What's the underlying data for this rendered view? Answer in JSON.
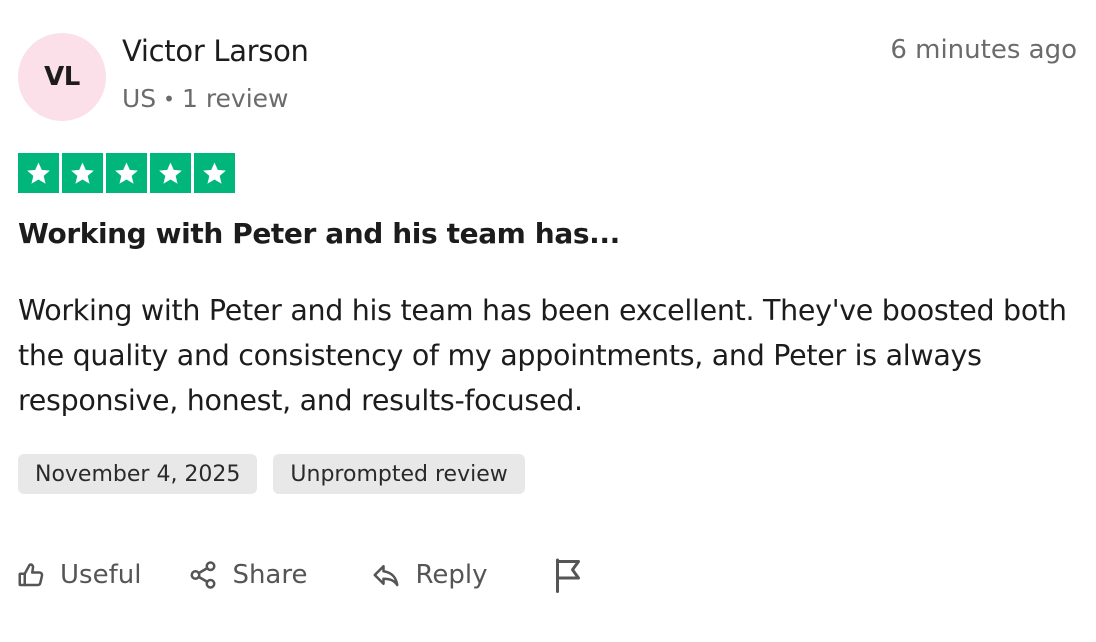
{
  "reviewer": {
    "initials": "VL",
    "name": "Victor Larson",
    "country": "US",
    "separator": "•",
    "review_count": "1 review",
    "avatar_color": "#fbe0ea"
  },
  "timestamp": "6 minutes ago",
  "rating": {
    "stars": 5,
    "max": 5,
    "color": "#00b67a",
    "icon": "star-icon"
  },
  "review": {
    "title": "Working with Peter and his team has...",
    "body": "Working with Peter and his team has been excellent. They've boosted both the quality and consistency of my appointments, and Peter is always responsive, honest, and results-focused."
  },
  "tags": [
    "November 4, 2025",
    "Unprompted review"
  ],
  "actions": {
    "useful": {
      "label": "Useful",
      "icon": "thumbs-up-icon"
    },
    "share": {
      "label": "Share",
      "icon": "share-icon"
    },
    "reply": {
      "label": "Reply",
      "icon": "reply-icon"
    },
    "report": {
      "icon": "flag-icon"
    }
  }
}
